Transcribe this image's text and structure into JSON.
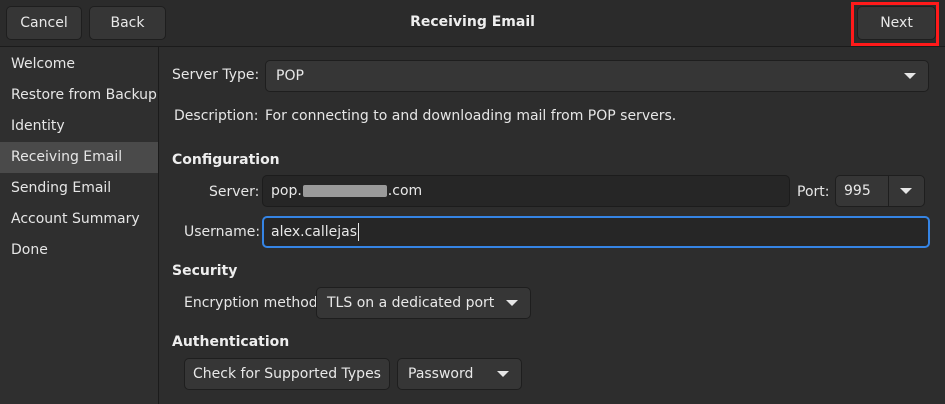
{
  "header": {
    "cancel_label": "Cancel",
    "back_label": "Back",
    "title": "Receiving Email",
    "next_label": "Next"
  },
  "sidebar": {
    "items": [
      {
        "label": "Welcome"
      },
      {
        "label": "Restore from Backup"
      },
      {
        "label": "Identity"
      },
      {
        "label": "Receiving Email"
      },
      {
        "label": "Sending Email"
      },
      {
        "label": "Account Summary"
      },
      {
        "label": "Done"
      }
    ],
    "active_index": 3
  },
  "form": {
    "server_type_label": "Server Type:",
    "server_type_value": "POP",
    "description_label": "Description:",
    "description_text": "For connecting to and downloading mail from POP servers.",
    "configuration_heading": "Configuration",
    "server_label": "Server:",
    "server_prefix": "pop.",
    "server_suffix": ".com",
    "port_label": "Port:",
    "port_value": "995",
    "username_label": "Username:",
    "username_value": "alex.callejas",
    "security_heading": "Security",
    "encryption_label": "Encryption method:",
    "encryption_value": "TLS on a dedicated port",
    "authentication_heading": "Authentication",
    "check_types_label": "Check for Supported Types",
    "auth_value": "Password"
  },
  "colors": {
    "background": "#2d2d2d",
    "accent_focus": "#3584e4",
    "highlight_box": "#ff1a1a"
  }
}
